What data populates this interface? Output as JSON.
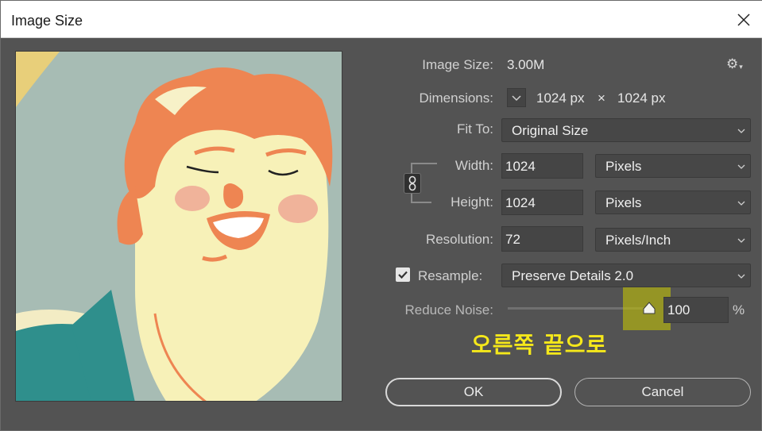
{
  "window": {
    "title": "Image Size"
  },
  "image_size": {
    "label": "Image Size:",
    "value": "3.00M"
  },
  "dimensions": {
    "label": "Dimensions:",
    "width": "1024 px",
    "separator": "×",
    "height": "1024 px"
  },
  "fit_to": {
    "label": "Fit To:",
    "value": "Original Size"
  },
  "width": {
    "label": "Width:",
    "value": "1024",
    "unit": "Pixels"
  },
  "height": {
    "label": "Height:",
    "value": "1024",
    "unit": "Pixels"
  },
  "resolution": {
    "label": "Resolution:",
    "value": "72",
    "unit": "Pixels/Inch"
  },
  "resample": {
    "label": "Resample:",
    "checked": true,
    "value": "Preserve Details 2.0"
  },
  "reduce_noise": {
    "label": "Reduce Noise:",
    "value": "100",
    "unit": "%",
    "level": 1.0
  },
  "annotation": {
    "text": "오른쪽 끝으로",
    "color": "#f5e81a"
  },
  "buttons": {
    "ok": "OK",
    "cancel": "Cancel"
  },
  "icons": {
    "close": "close-icon",
    "settings": "gear-icon",
    "link": "chain-link-icon",
    "dropdown": "chevron-down-icon"
  }
}
